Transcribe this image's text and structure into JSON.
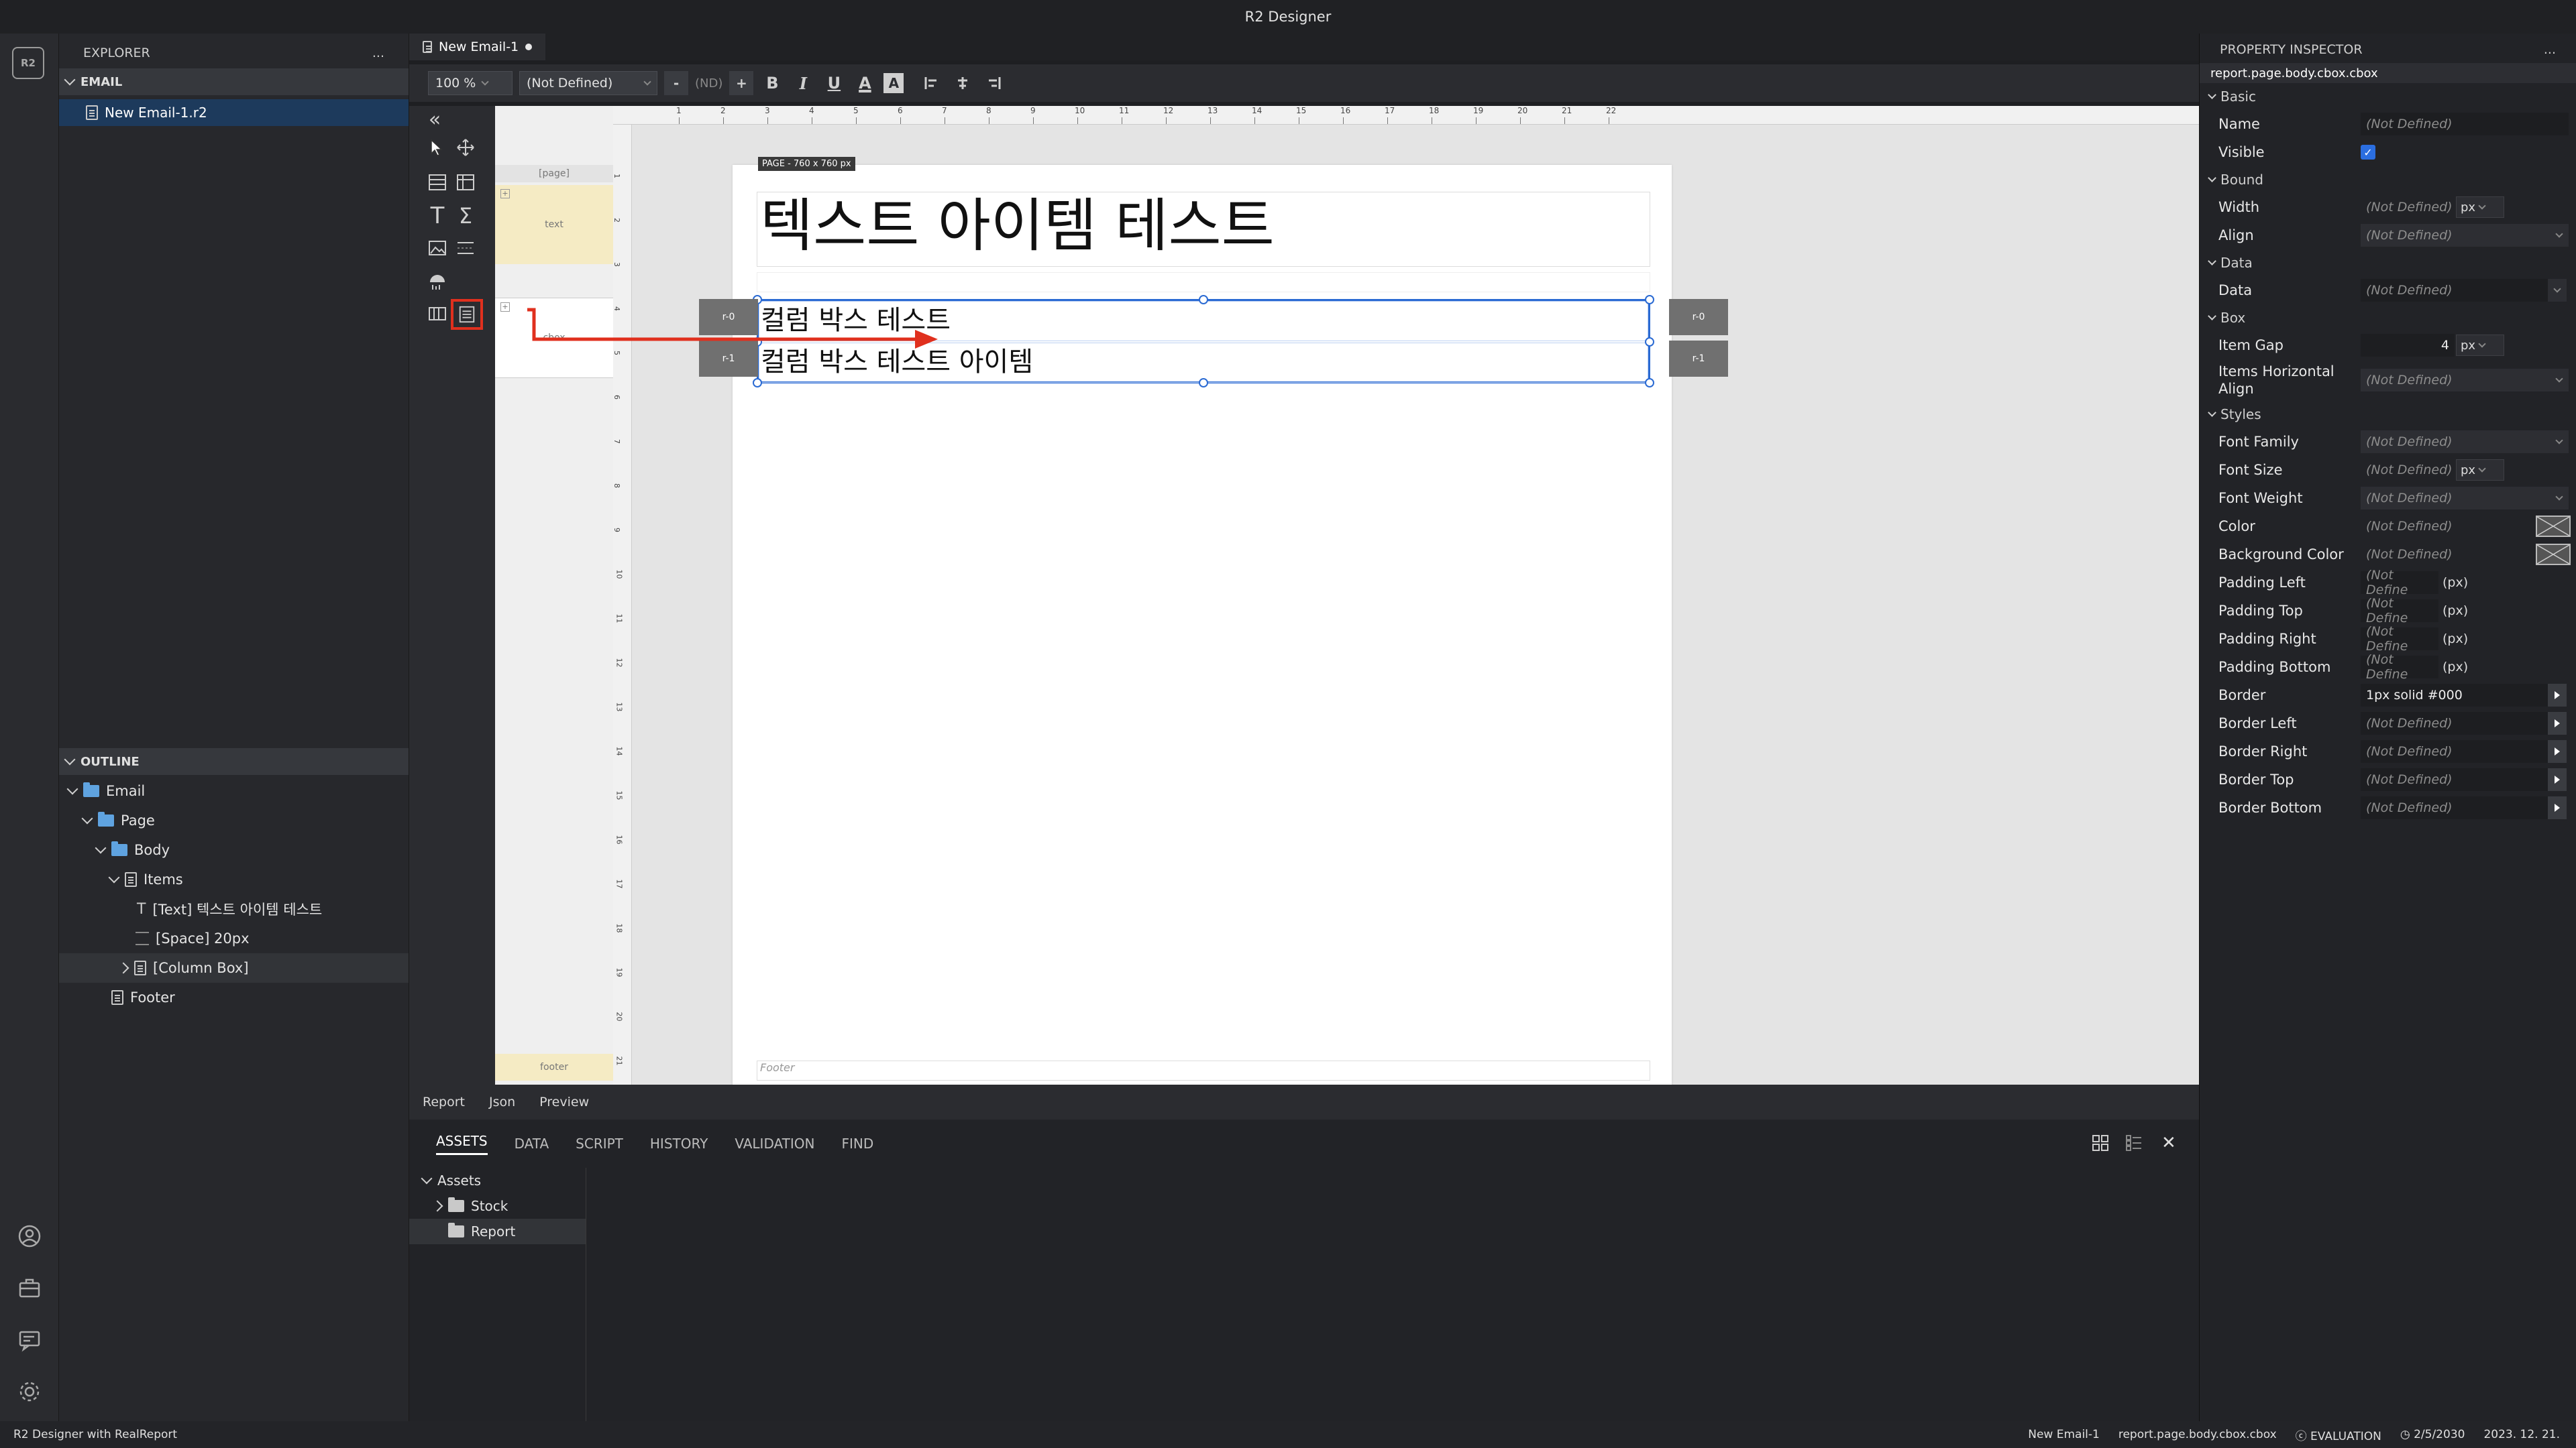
{
  "window": {
    "title": "R2 Designer"
  },
  "activity": {
    "logo": "R2",
    "icons": [
      "account-icon",
      "toolbox-icon",
      "feedback-icon",
      "settings-icon"
    ]
  },
  "explorer": {
    "title": "EXPLORER",
    "menu": "...",
    "section": "EMAIL",
    "file": "New Email-1.r2",
    "outline_title": "OUTLINE",
    "outline": [
      {
        "label": "Email",
        "depth": 0,
        "icon": "folder-blue"
      },
      {
        "label": "Page",
        "depth": 1,
        "icon": "folder-blue"
      },
      {
        "label": "Body",
        "depth": 2,
        "icon": "folder-blue"
      },
      {
        "label": "Items",
        "depth": 3,
        "icon": "list"
      },
      {
        "label": "[Text] 텍스트 아이템 테스트",
        "depth": 4,
        "icon": "text"
      },
      {
        "label": "[Space] 20px",
        "depth": 4,
        "icon": "space"
      },
      {
        "label": "[Column Box]",
        "depth": 4,
        "icon": "list"
      },
      {
        "label": "Footer",
        "depth": 2,
        "icon": "list"
      }
    ]
  },
  "editor": {
    "tab": "New Email-1",
    "toolbar": {
      "zoom": "100 %",
      "style": "(Not Defined)",
      "minus": "-",
      "nd": "(ND)",
      "plus": "+",
      "bold": "B",
      "italic": "I",
      "underline": "U",
      "font_color": "A",
      "bg_color": "A"
    },
    "ruler_numbers": [
      "1",
      "2",
      "3",
      "4",
      "5",
      "6",
      "7",
      "8",
      "9",
      "10",
      "11",
      "12",
      "13",
      "14",
      "15",
      "16",
      "17",
      "18",
      "19",
      "20",
      "21",
      "22"
    ],
    "ruler_left_numbers": [
      "1",
      "2",
      "3",
      "4",
      "5",
      "6",
      "7",
      "8",
      "9",
      "10",
      "11",
      "12",
      "13",
      "14",
      "15",
      "16",
      "17",
      "18",
      "19",
      "20",
      "21"
    ],
    "bands": {
      "page": "[page]",
      "text": "text",
      "cbox": "cbox",
      "footer": "footer"
    },
    "page_label": "PAGE - 760 x 760 px",
    "title_text": "텍스트 아이템 테스트",
    "rows": [
      {
        "tag_left": "r-0",
        "text": "컬럼 박스 테스트",
        "tag_right": "r-0"
      },
      {
        "tag_left": "r-1",
        "text": "컬럼 박스 테스트 아이템",
        "tag_right": "r-1"
      }
    ],
    "footer_text": "Footer",
    "bottom_tabs": [
      "Report",
      "Json",
      "Preview"
    ]
  },
  "assets": {
    "tabs": [
      "ASSETS",
      "DATA",
      "SCRIPT",
      "HISTORY",
      "VALIDATION",
      "FIND"
    ],
    "active_tab": "ASSETS",
    "tree": [
      {
        "label": "Assets",
        "depth": 0
      },
      {
        "label": "Stock",
        "depth": 1
      },
      {
        "label": "Report",
        "depth": 1
      }
    ],
    "close": "✕"
  },
  "inspector": {
    "title": "PROPERTY INSPECTOR",
    "menu": "...",
    "path": "report.page.body.cbox.cbox",
    "sections": [
      {
        "title": "Basic",
        "rows": [
          {
            "label": "Name",
            "value": "(Not Defined)",
            "kind": "text"
          },
          {
            "label": "Visible",
            "value": "",
            "kind": "checkbox"
          }
        ]
      },
      {
        "title": "Bound",
        "rows": [
          {
            "label": "Width",
            "value": "(Not Defined)",
            "kind": "unit",
            "unit": "px"
          },
          {
            "label": "Align",
            "value": "(Not Defined)",
            "kind": "select"
          }
        ]
      },
      {
        "title": "Data",
        "rows": [
          {
            "label": "Data",
            "value": "(Not Defined)",
            "kind": "select-short"
          }
        ]
      },
      {
        "title": "Box",
        "rows": [
          {
            "label": "Item Gap",
            "value": "4",
            "kind": "unit-num",
            "unit": "px"
          },
          {
            "label": "Items Horizontal Align",
            "value": "(Not Defined)",
            "kind": "select"
          }
        ]
      },
      {
        "title": "Styles",
        "rows": [
          {
            "label": "Font Family",
            "value": "(Not Defined)",
            "kind": "select"
          },
          {
            "label": "Font Size",
            "value": "(Not Defined)",
            "kind": "unit",
            "unit": "px"
          },
          {
            "label": "Font Weight",
            "value": "(Not Defined)",
            "kind": "select"
          },
          {
            "label": "Color",
            "value": "(Not Defined)",
            "kind": "color"
          },
          {
            "label": "Background Color",
            "value": "(Not Defined)",
            "kind": "color"
          },
          {
            "label": "Padding Left",
            "value": "(Not Define",
            "kind": "px",
            "unit": "(px)"
          },
          {
            "label": "Padding Top",
            "value": "(Not Define",
            "kind": "px",
            "unit": "(px)"
          },
          {
            "label": "Padding Right",
            "value": "(Not Define",
            "kind": "px",
            "unit": "(px)"
          },
          {
            "label": "Padding Bottom",
            "value": "(Not Define",
            "kind": "px",
            "unit": "(px)"
          },
          {
            "label": "Border",
            "value": "1px solid #000",
            "kind": "arrow"
          },
          {
            "label": "Border Left",
            "value": "(Not Defined)",
            "kind": "arrow"
          },
          {
            "label": "Border Right",
            "value": "(Not Defined)",
            "kind": "arrow"
          },
          {
            "label": "Border Top",
            "value": "(Not Defined)",
            "kind": "arrow"
          },
          {
            "label": "Border Bottom",
            "value": "(Not Defined)",
            "kind": "arrow"
          }
        ]
      }
    ]
  },
  "status": {
    "left": "R2 Designer with RealReport",
    "file": "New Email-1",
    "path": "report.page.body.cbox.cbox",
    "eval": "EVALUATION",
    "expiry": "2/5/2030",
    "date": "2023. 12. 21."
  },
  "colors": {
    "accent": "#2a6ad3",
    "selection": "#1d3a5c",
    "highlight": "#e0301e"
  }
}
